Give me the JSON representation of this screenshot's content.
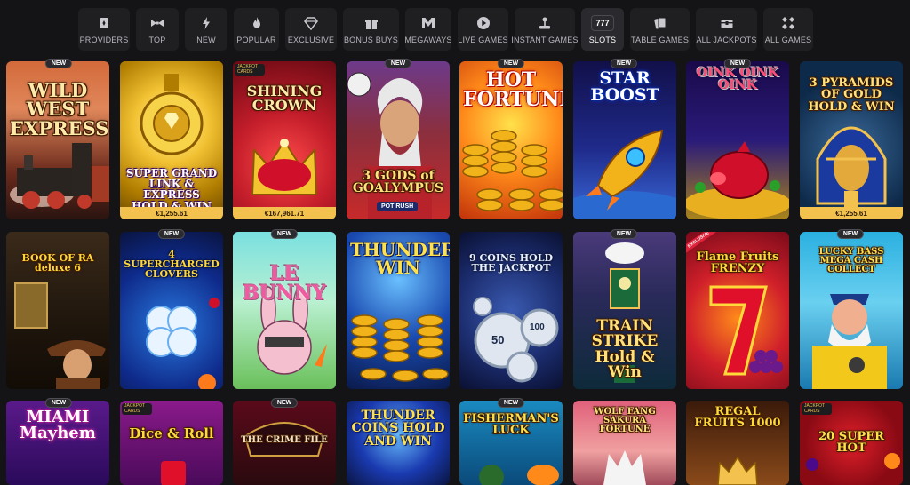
{
  "nav": {
    "items": [
      {
        "label": "PROVIDERS",
        "icon": "providers-icon"
      },
      {
        "label": "TOP",
        "icon": "bowtie-icon"
      },
      {
        "label": "NEW",
        "icon": "lightning-icon"
      },
      {
        "label": "POPULAR",
        "icon": "flame-icon"
      },
      {
        "label": "EXCLUSIVE",
        "icon": "diamond-icon"
      },
      {
        "label": "BONUS BUYS",
        "icon": "gift-icon"
      },
      {
        "label": "MEGAWAYS",
        "icon": "megaways-icon"
      },
      {
        "label": "LIVE GAMES",
        "icon": "play-icon"
      },
      {
        "label": "INSTANT GAMES",
        "icon": "joystick-icon"
      },
      {
        "label": "SLOTS",
        "icon": "slots-777-icon",
        "active": true,
        "icon_text": "777"
      },
      {
        "label": "TABLE GAMES",
        "icon": "cards-icon"
      },
      {
        "label": "ALL JACKPOTS",
        "icon": "jackpot-chest-icon"
      },
      {
        "label": "ALL GAMES",
        "icon": "all-games-icon"
      }
    ]
  },
  "badges": {
    "new": "NEW",
    "exclusive": "EXCLUSIVE"
  },
  "games": [
    {
      "title": "WILD WEST EXPRESS",
      "badge": "NEW",
      "jackpot": ""
    },
    {
      "title": "SUPER GRAND LINK & EXPRESS HOLD & WIN",
      "badge": "",
      "jackpot": "€1,255.61"
    },
    {
      "title": "SHINING CROWN",
      "badge": "",
      "jackpot": "€167,961.71",
      "corner": "JACKPOT CARDS"
    },
    {
      "title": "3 GODS of GOALYMPUS",
      "badge": "NEW",
      "jackpot": "",
      "subtag": "POT RUSH"
    },
    {
      "title": "HOT FORTUNE",
      "badge": "NEW",
      "jackpot": ""
    },
    {
      "title": "STAR BOOST",
      "badge": "NEW",
      "jackpot": ""
    },
    {
      "title": "OINK OINK OINK",
      "badge": "NEW",
      "jackpot": ""
    },
    {
      "title": "3 PYRAMIDS OF GOLD HOLD & WIN",
      "badge": "",
      "jackpot": "€1,255.61"
    },
    {
      "title": "BOOK OF RA deluxe 6",
      "badge": "",
      "jackpot": ""
    },
    {
      "title": "4 SUPERCHARGED CLOVERS",
      "badge": "NEW",
      "jackpot": ""
    },
    {
      "title": "LE BUNNY",
      "badge": "NEW",
      "jackpot": ""
    },
    {
      "title": "THUNDER WIN",
      "badge": "",
      "jackpot": ""
    },
    {
      "title": "9 COINS HOLD THE JACKPOT",
      "badge": "",
      "jackpot": "",
      "chips": [
        "50",
        "100"
      ]
    },
    {
      "title": "TRAIN STRIKE Hold & Win",
      "badge": "NEW",
      "jackpot": ""
    },
    {
      "title": "Flame Fruits FRENZY",
      "badge": "",
      "jackpot": "",
      "ribbon": "EXCLUSIVE"
    },
    {
      "title": "LUCKY BASS MEGA CASH COLLECT",
      "badge": "NEW",
      "jackpot": ""
    },
    {
      "title": "MIAMI Mayhem",
      "badge": "NEW",
      "jackpot": ""
    },
    {
      "title": "Dice & Roll",
      "badge": "",
      "jackpot": "",
      "corner": "JACKPOT CARDS"
    },
    {
      "title": "THE CRIME FILE",
      "badge": "NEW",
      "jackpot": ""
    },
    {
      "title": "THUNDER COINS HOLD AND WIN",
      "badge": "",
      "jackpot": ""
    },
    {
      "title": "FISHERMAN'S LUCK",
      "badge": "NEW",
      "jackpot": ""
    },
    {
      "title": "WOLF FANG SAKURA FORTUNE",
      "badge": "",
      "jackpot": ""
    },
    {
      "title": "REGAL FRUITS 1000",
      "badge": "",
      "jackpot": ""
    },
    {
      "title": "20 SUPER HOT",
      "badge": "",
      "jackpot": "",
      "corner": "JACKPOT CARDS"
    }
  ],
  "theme": {
    "background": "#141416",
    "nav_bg": "#1f1f22",
    "jackpot_bar": "#f2c14e"
  }
}
